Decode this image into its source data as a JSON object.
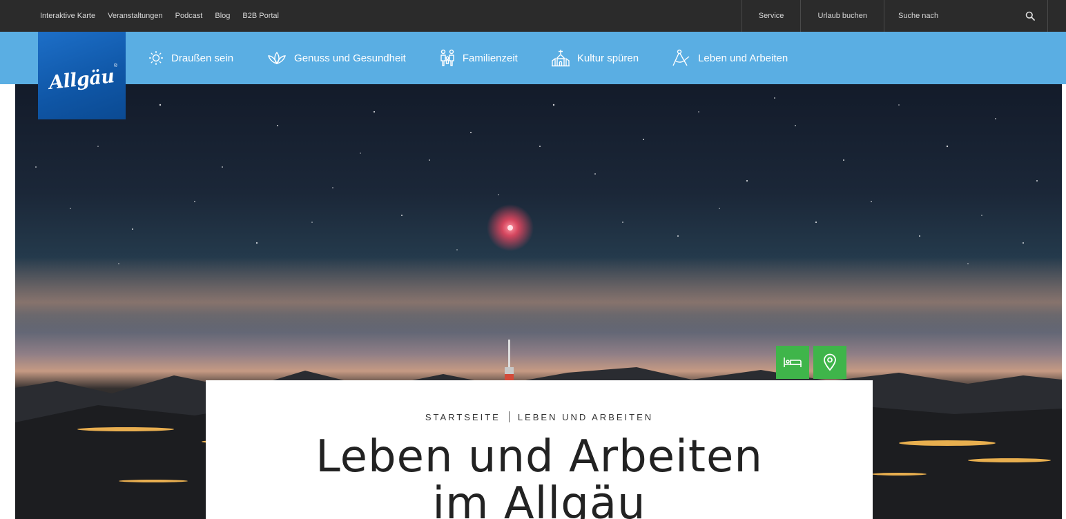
{
  "topbar": {
    "links": [
      "Interaktive Karte",
      "Veranstaltungen",
      "Podcast",
      "Blog",
      "B2B Portal"
    ],
    "service": "Service",
    "book": "Urlaub buchen",
    "search_placeholder": "Suche nach"
  },
  "logo": {
    "text": "Allgäu",
    "registered": "®"
  },
  "mainnav": {
    "items": [
      {
        "label": "Draußen sein",
        "icon": "sun-gear-icon"
      },
      {
        "label": "Genuss und Gesundheit",
        "icon": "lotus-icon"
      },
      {
        "label": "Familienzeit",
        "icon": "family-icon"
      },
      {
        "label": "Kultur spüren",
        "icon": "church-icon"
      },
      {
        "label": "Leben und Arbeiten",
        "icon": "compass-icon"
      }
    ]
  },
  "hero": {
    "buttons": [
      {
        "icon": "bed-icon"
      },
      {
        "icon": "location-pin-icon"
      }
    ]
  },
  "card": {
    "breadcrumb": [
      "STARTSEITE",
      "LEBEN UND ARBEITEN"
    ],
    "title_line1": "Leben und Arbeiten",
    "title_line2": "im Allgäu"
  },
  "colors": {
    "topbar": "#2b2b2b",
    "nav": "#5aaee3",
    "logo": "#0f56a6",
    "accent_green": "#3fb54a"
  }
}
